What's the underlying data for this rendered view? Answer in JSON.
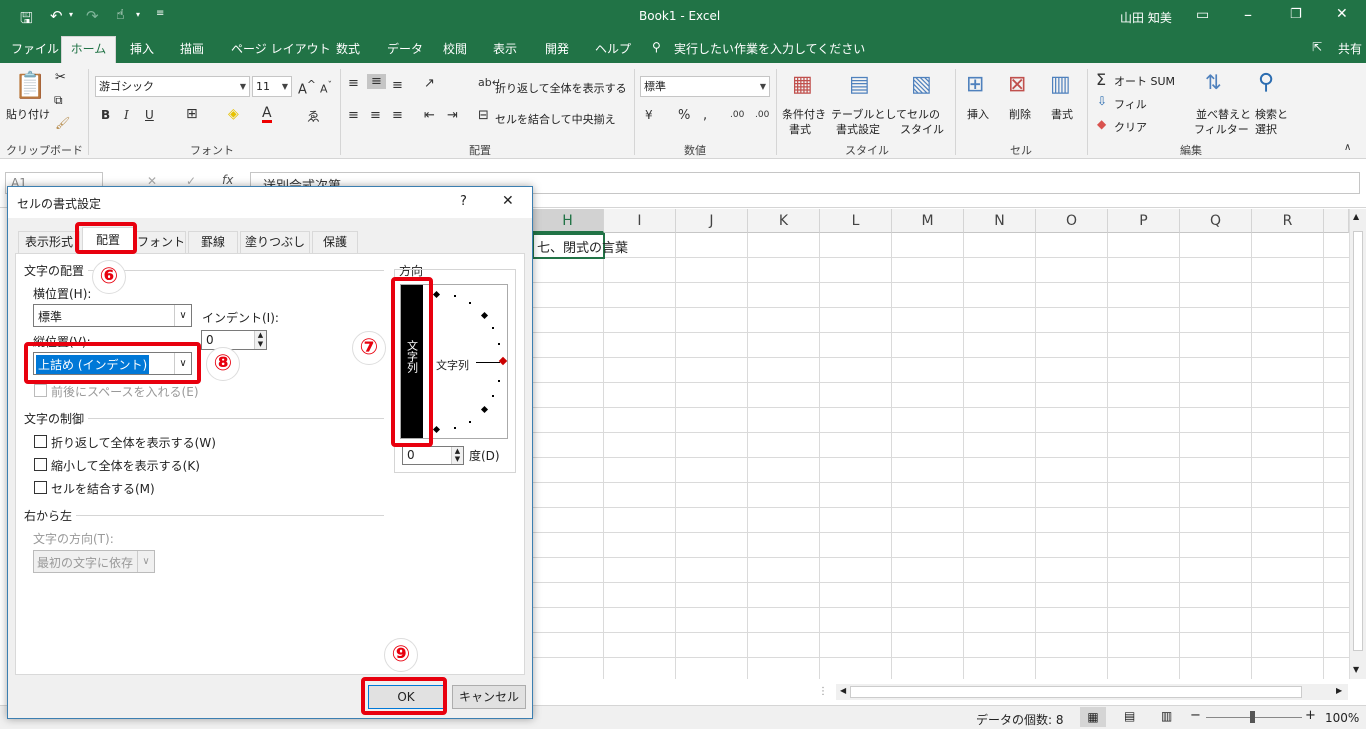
{
  "titlebar": {
    "title": "Book1  -  Excel",
    "user": "山田 知美"
  },
  "tabs": [
    "ファイル",
    "ホーム",
    "挿入",
    "描画",
    "ページ レイアウト",
    "数式",
    "データ",
    "校閲",
    "表示",
    "開発",
    "ヘルプ"
  ],
  "tellme": "実行したい作業を入力してください",
  "share": "共有",
  "ribbon": {
    "clipboard": {
      "paste": "貼り付け",
      "label": "クリップボード"
    },
    "font": {
      "name": "游ゴシック",
      "size": "11",
      "bold": "B",
      "italic": "I",
      "underline": "U",
      "label": "フォント"
    },
    "alignment": {
      "wrap": "折り返して全体を表示する",
      "merge": "セルを結合して中央揃え",
      "label": "配置"
    },
    "number": {
      "format": "標準",
      "label": "数値"
    },
    "styles": {
      "cond1": "条件付き",
      "cond2": "書式",
      "table1": "テーブルとして",
      "table2": "書式設定",
      "cell1": "セルの",
      "cell2": "スタイル",
      "label": "スタイル"
    },
    "cells": {
      "insert": "挿入",
      "delete": "削除",
      "format": "書式",
      "label": "セル"
    },
    "editing": {
      "autosum": "オート SUM",
      "fill": "フィル",
      "clear": "クリア",
      "sort1": "並べ替えと",
      "sort2": "フィルター",
      "find1": "検索と",
      "find2": "選択",
      "label": "編集"
    }
  },
  "formula": {
    "namebox": "A1",
    "content": "送別会式次第"
  },
  "columns": [
    "H",
    "I",
    "J",
    "K",
    "L",
    "M",
    "N",
    "O",
    "P",
    "Q",
    "R"
  ],
  "cell_text": "七、閉式の言葉",
  "status": {
    "count": "データの個数: 8",
    "zoom": "100%"
  },
  "dialog": {
    "title": "セルの書式設定",
    "help": "?",
    "close": "✕",
    "tabs": [
      "表示形式",
      "配置",
      "フォント",
      "罫線",
      "塗りつぶし",
      "保護"
    ],
    "text_alignment": "文字の配置",
    "horizontal_label": "横位置(H):",
    "horizontal_value": "標準",
    "indent_label": "インデント(I):",
    "indent_value": "0",
    "vertical_label": "縦位置(V):",
    "vertical_value": "上詰め (インデント)",
    "distributed": "前後にスペースを入れる(E)",
    "text_control": "文字の制御",
    "wrap": "折り返して全体を表示する(W)",
    "shrink": "縮小して全体を表示する(K)",
    "merge": "セルを結合する(M)",
    "rtl": "右から左",
    "direction_label": "文字の方向(T):",
    "direction_value": "最初の文字に依存",
    "orientation": "方向",
    "vertical_text": "文字列",
    "rotated_text": "文字列",
    "degree_value": "0",
    "degree_label": "度(D)",
    "ok": "OK",
    "cancel": "キャンセル"
  },
  "annotations": [
    "⑥",
    "⑦",
    "⑧",
    "⑨"
  ],
  "colors": {
    "excel_green": "#217346",
    "highlight_red": "#e8000e",
    "select_blue": "#0078d7"
  }
}
